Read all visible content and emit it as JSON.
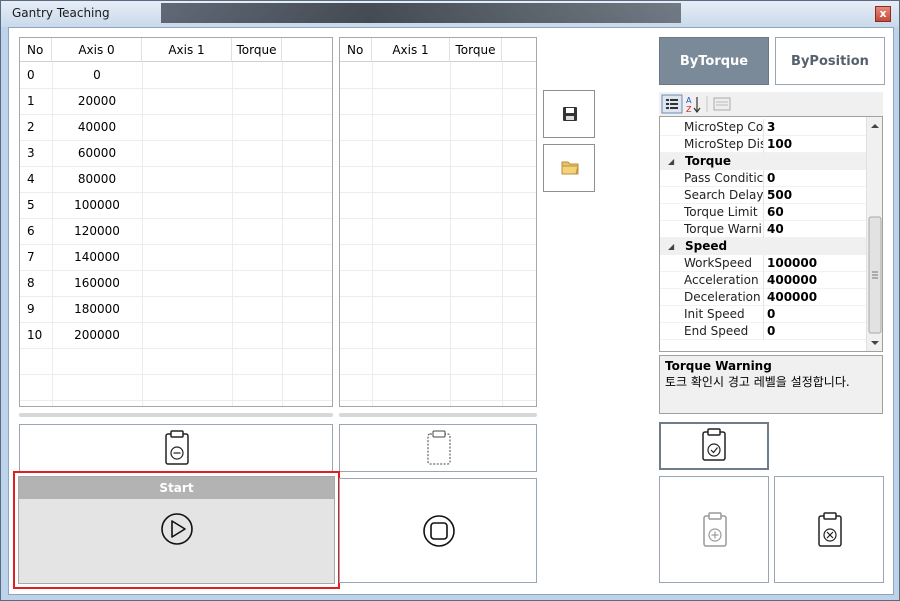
{
  "window": {
    "title": "Gantry Teaching",
    "close_glyph": "x"
  },
  "grid_left": {
    "columns": [
      "No",
      "Axis  0",
      "Axis  1",
      "Torque"
    ],
    "rows": [
      [
        "0",
        "0"
      ],
      [
        "1",
        "20000"
      ],
      [
        "2",
        "40000"
      ],
      [
        "3",
        "60000"
      ],
      [
        "4",
        "80000"
      ],
      [
        "5",
        "100000"
      ],
      [
        "6",
        "120000"
      ],
      [
        "7",
        "140000"
      ],
      [
        "8",
        "160000"
      ],
      [
        "9",
        "180000"
      ],
      [
        "10",
        "200000"
      ]
    ]
  },
  "grid_right": {
    "columns": [
      "No",
      "Axis  1",
      "Torque"
    ]
  },
  "tabs": {
    "by_torque": "ByTorque",
    "by_position": "ByPosition"
  },
  "property_grid": {
    "rows": [
      {
        "kind": "prop",
        "name": "MicroStep Co",
        "value": "3"
      },
      {
        "kind": "prop",
        "name": "MicroStep Dis",
        "value": "100"
      },
      {
        "kind": "cat",
        "name": "Torque"
      },
      {
        "kind": "prop",
        "name": "Pass Conditic",
        "value": "0"
      },
      {
        "kind": "prop",
        "name": "Search Delay",
        "value": "500"
      },
      {
        "kind": "prop",
        "name": "Torque Limit",
        "value": "60"
      },
      {
        "kind": "prop",
        "name": "Torque Warnii",
        "value": "40"
      },
      {
        "kind": "cat",
        "name": "Speed"
      },
      {
        "kind": "prop",
        "name": "WorkSpeed",
        "value": "100000"
      },
      {
        "kind": "prop",
        "name": "Acceleration",
        "value": "400000"
      },
      {
        "kind": "prop",
        "name": "Deceleration",
        "value": "400000"
      },
      {
        "kind": "prop",
        "name": "Init Speed",
        "value": "0"
      },
      {
        "kind": "prop",
        "name": "End Speed",
        "value": "0"
      }
    ]
  },
  "description": {
    "title": "Torque Warning",
    "text": "토크 확인시 경고 레벨을 설정합니다."
  },
  "start_button": {
    "label": "Start"
  },
  "colors": {
    "highlight": "#e02020",
    "tab_active": "#7a8a99"
  },
  "icons": {
    "save": "save-icon",
    "open": "folder-icon",
    "clipboard_minus": "clipboard-minus-icon",
    "clipboard_empty": "clipboard-icon",
    "clipboard_check": "clipboard-check-icon",
    "clipboard_add": "clipboard-add-icon",
    "clipboard_delete": "clipboard-delete-icon",
    "play": "play-icon",
    "stop": "stop-icon"
  }
}
